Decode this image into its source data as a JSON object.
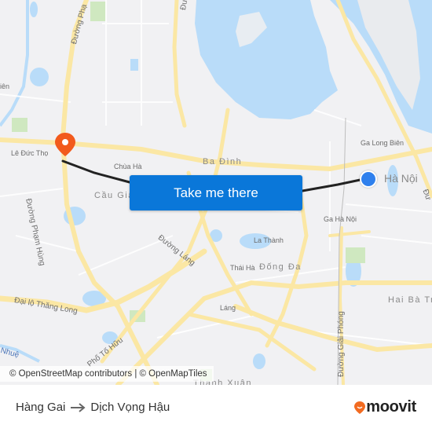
{
  "map": {
    "labels": {
      "le_duc_tho": "Lê Đức Thọ",
      "chua_ha": "Chùa Hà",
      "cau_giay": "Cầu Giấy",
      "ba_dinh": "Ba Đình",
      "ga_long_bien": "Ga Long Biên",
      "ha_noi": "Hà Nội",
      "ga_ha_noi": "Ga Hà Nội",
      "la_thanh": "La Thành",
      "thai_ha": "Thái Hà",
      "dong_da": "Đống Đa",
      "lang": "Láng",
      "hai_ba_trung": "Hai Bà Trư",
      "thanh_xuan": "Thanh Xuân",
      "duong_pham_hung": "Đường Phạm Hùng",
      "duong_pham_top": "Đường Phạ",
      "duong_lang": "Đường Láng",
      "dai_lo_thang_long": "Đại lộ Thăng Long",
      "pho_to_huu": "Phố Tố Hữu",
      "duong_giai_phong": "Đường Giải Phóng",
      "nhue": "Nhuệ",
      "bien_left": "iên",
      "duong_top": "Đư",
      "duong_right": "Đư"
    },
    "attribution": "© OpenStreetMap contributors | © OpenMapTiles",
    "cta_label": "Take me there",
    "colors": {
      "water": "#b9dcf9",
      "road": "#fbe7a4",
      "park": "#cfe8c0",
      "route": "#222222",
      "origin": "#2f80ed",
      "destination": "#f25a1c",
      "cta": "#0a77d9"
    }
  },
  "footer": {
    "origin": "Hàng Gai",
    "destination": "Dịch Vọng Hậu",
    "brand": "moovit",
    "brand_color": "#f26b21"
  }
}
